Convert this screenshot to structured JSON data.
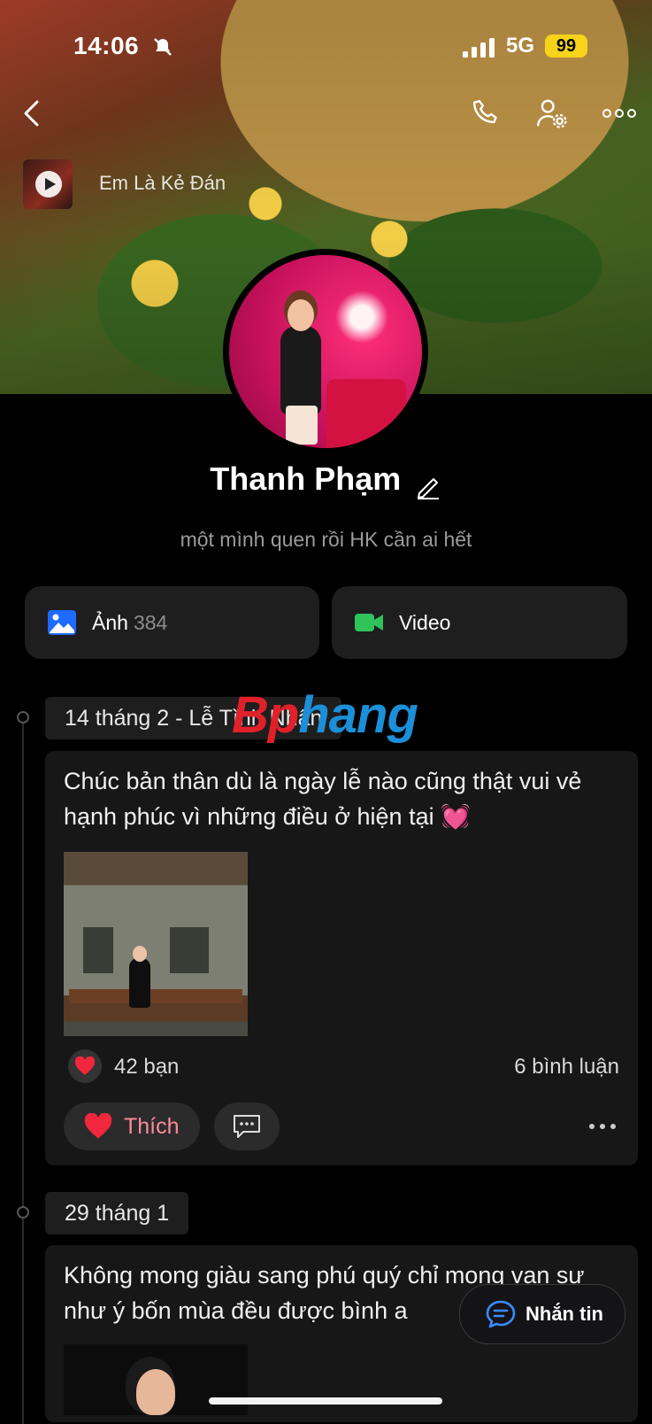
{
  "status_bar": {
    "time": "14:06",
    "network": "5G",
    "battery": "99"
  },
  "music": {
    "title": "Em Là Kẻ Đán"
  },
  "profile": {
    "name": "Thanh Phạm",
    "bio": "một mình quen rồi HK cần ai hết"
  },
  "media_tiles": {
    "photos_label": "Ảnh",
    "photos_count": "384",
    "video_label": "Video"
  },
  "watermark": {
    "part1": "Bp",
    "part2": "hang"
  },
  "posts": [
    {
      "date": "14 tháng 2 - Lễ Tình Nhân",
      "text": "Chúc bản thân dù là ngày lễ nào cũng thật vui vẻ hạnh phúc vì những điều ở hiện tại 💓",
      "reactions": "42 bạn",
      "comments": "6 bình luận",
      "like_label": "Thích"
    },
    {
      "date": "29 tháng 1",
      "text": "Không mong giàu sang phú quý chỉ mong vạn sự như ý bốn mùa đều được bình a"
    }
  ],
  "fab": {
    "label": "Nhắn tin"
  },
  "colors": {
    "accent_blue": "#1e6bff",
    "video_green": "#30c35a",
    "like_pink": "#ff8a9a",
    "battery_yellow": "#f7d319"
  }
}
